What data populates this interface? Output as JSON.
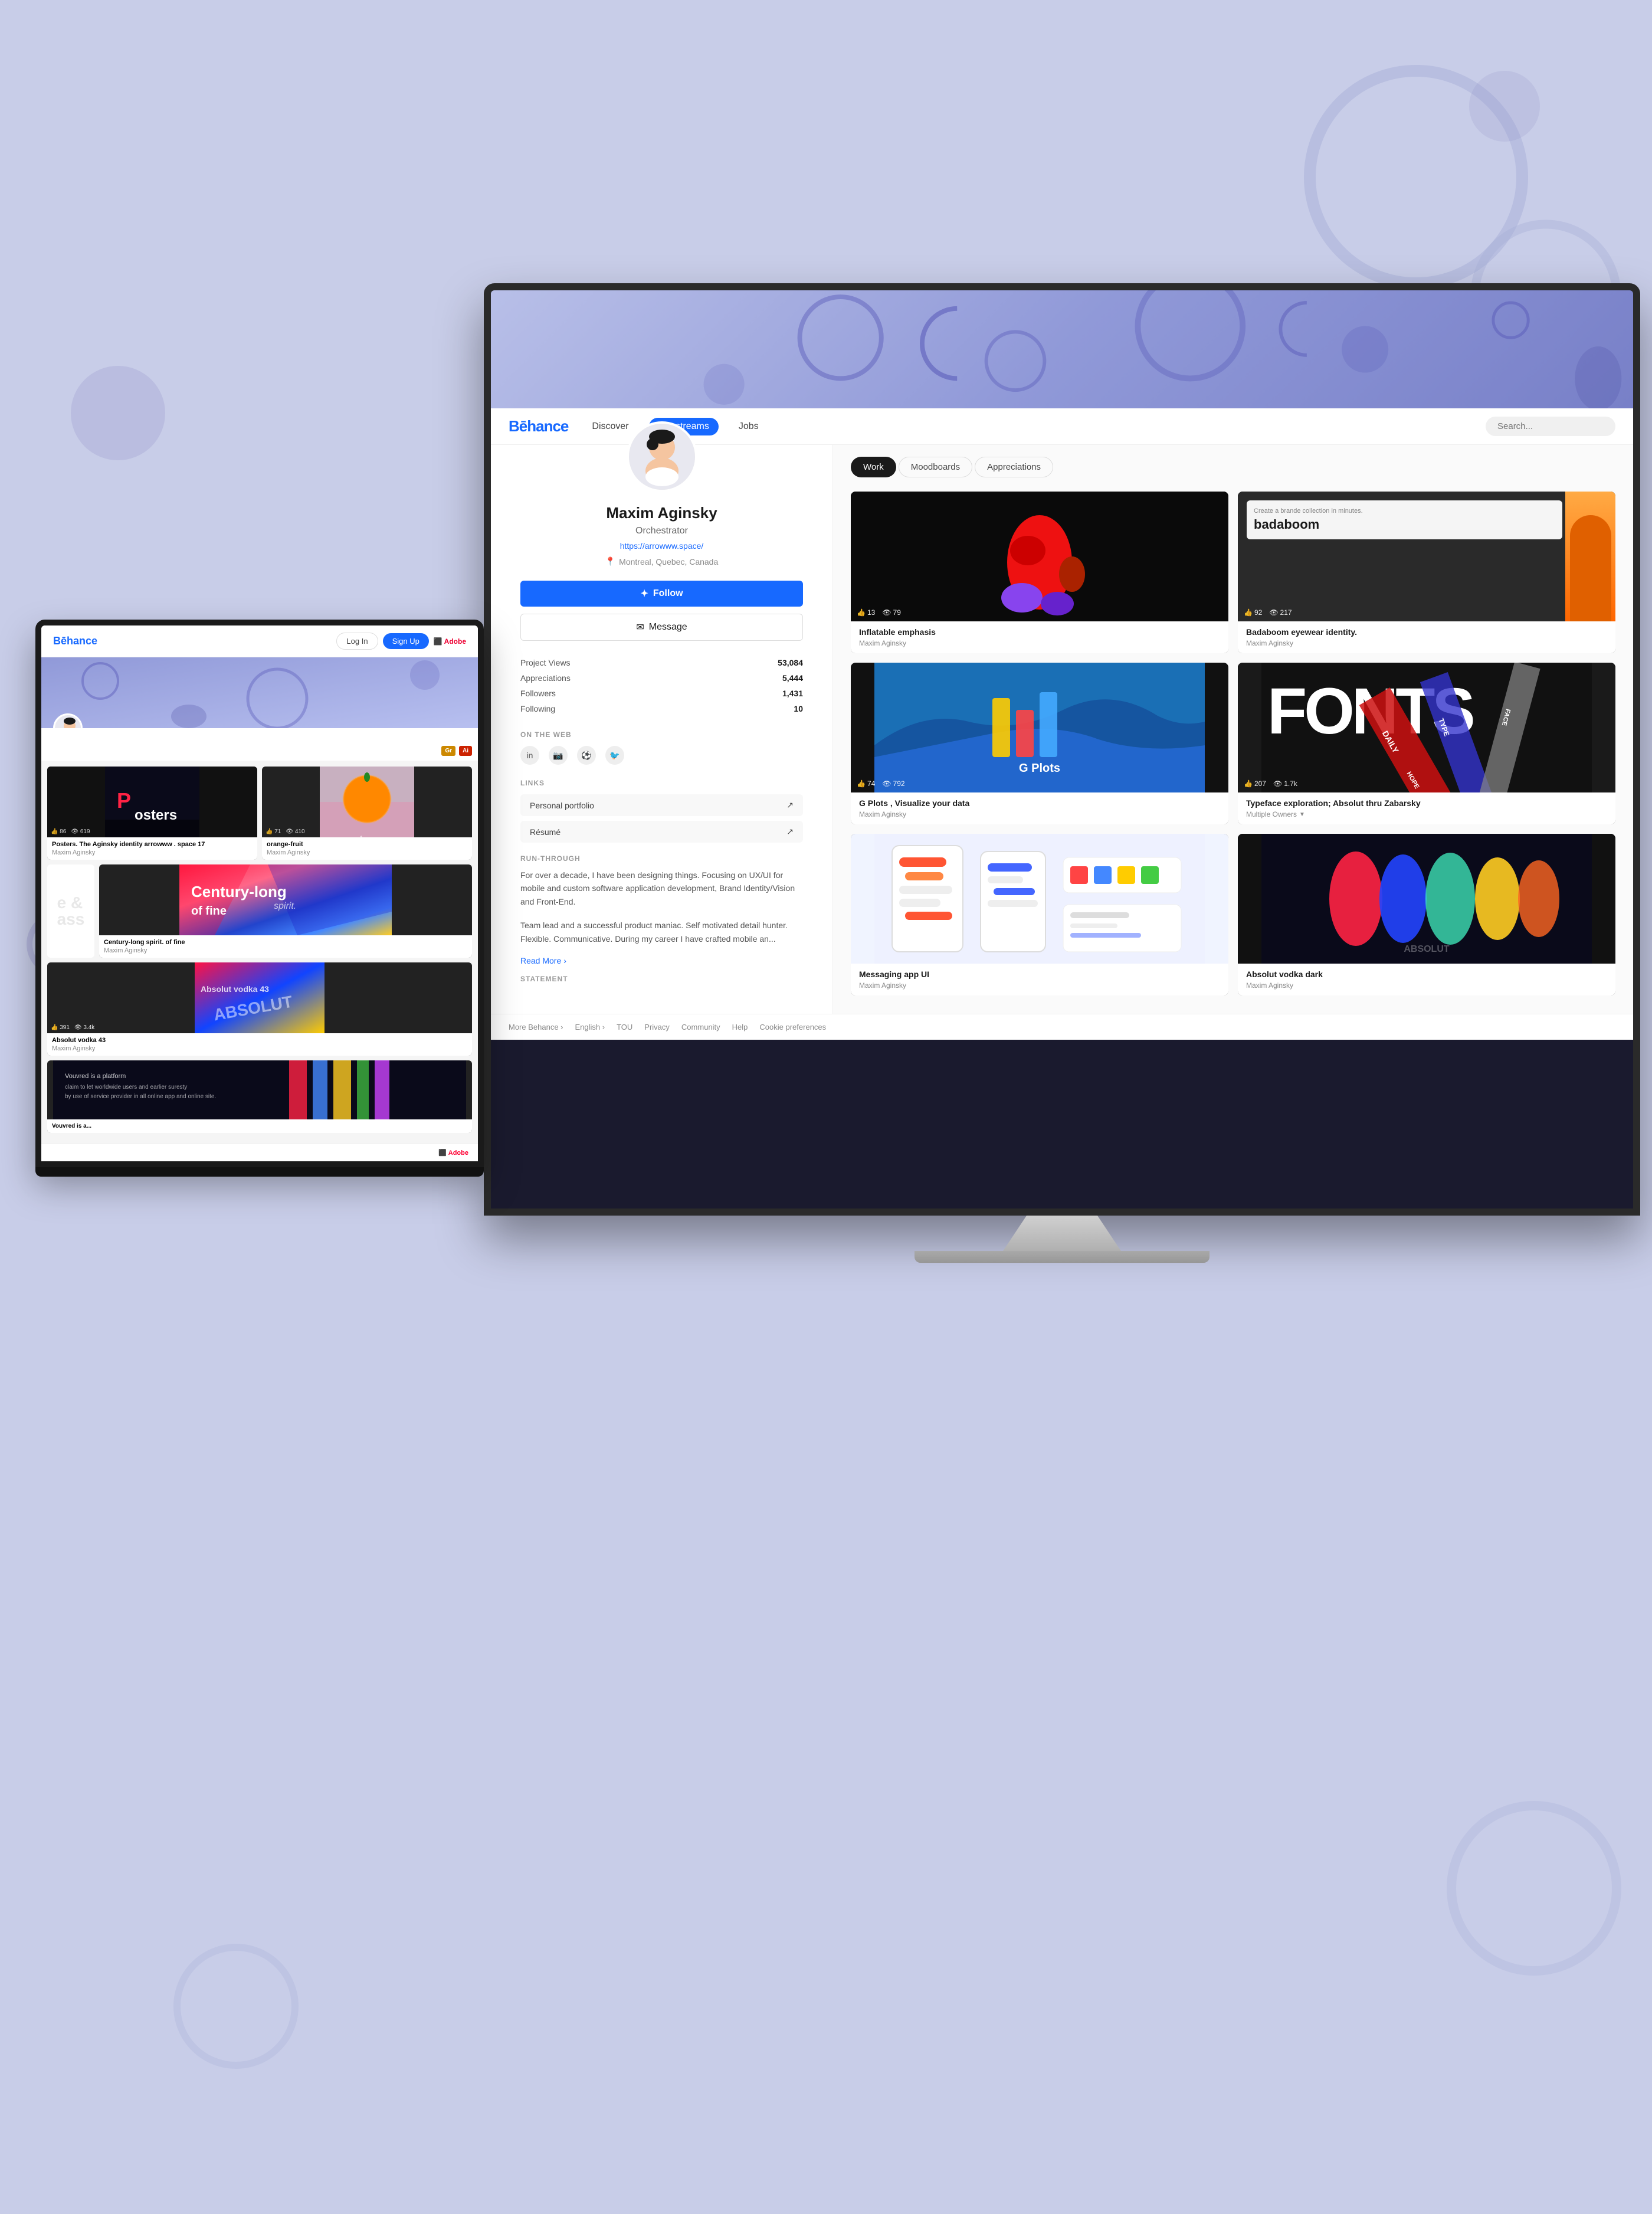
{
  "page": {
    "bg_color": "#c8cde8"
  },
  "behance": {
    "nav": {
      "logo": "Bēhance",
      "links": [
        "Discover",
        "Livestreams",
        "Jobs"
      ],
      "active_link": "Livestreams",
      "search_placeholder": "Search..."
    },
    "profile": {
      "name": "Maxim Aginsky",
      "title": "Orchestrator",
      "website": "https://arrowww.space/",
      "location": "Montreal, Quebec, Canada",
      "follow_btn": "Follow",
      "message_btn": "Message",
      "stats": {
        "project_views_label": "Project Views",
        "project_views_value": "53,084",
        "appreciations_label": "Appreciations",
        "appreciations_value": "5,444",
        "followers_label": "Followers",
        "followers_value": "1,431",
        "following_label": "Following",
        "following_value": "10"
      },
      "on_the_web_label": "ON THE WEB",
      "links_label": "LINKS",
      "links": [
        "Personal portfolio",
        "Résumé"
      ],
      "run_through_label": "RUN-THROUGH",
      "bio_text": "For over a decade, I have been designing things. Focusing on UX/UI for mobile and custom software application development, Brand Identity/Vision and Front-End.",
      "bio_text2": "Team lead and a successful product maniac. Self motivated detail hunter. Flexible. Communicative. During my career I have crafted mobile an...",
      "read_more": "Read More",
      "statement_label": "STATEMENT"
    },
    "tabs": {
      "work": "Work",
      "moodboards": "Moodboards",
      "appreciations": "Appreciations",
      "active": "Work"
    },
    "projects": [
      {
        "title": "Inflatable emphasis",
        "author": "Maxim Aginsky",
        "likes": "13",
        "views": "79",
        "style": "inflatable"
      },
      {
        "title": "Badaboom eyewear identity.",
        "author": "Maxim Aginsky",
        "likes": "92",
        "views": "217",
        "style": "badaboom"
      },
      {
        "title": "G Plots , Visualize your data",
        "author": "Maxim Aginsky",
        "likes": "74",
        "views": "792",
        "style": "gplots"
      },
      {
        "title": "Typeface exploration; Absolut thru Zabarsky",
        "author": "Multiple Owners",
        "likes": "207",
        "views": "1.7k",
        "style": "fonts",
        "has_arrow": true
      },
      {
        "title": "Messaging app UI",
        "author": "Maxim Aginsky",
        "style": "chat"
      },
      {
        "title": "Absolut vodka dark",
        "author": "Maxim Aginsky",
        "style": "absolut"
      }
    ],
    "footer": {
      "links": [
        "More Behance ›",
        "English ›",
        "TOU",
        "Privacy",
        "Community",
        "Help",
        "Cookie preferences"
      ]
    }
  },
  "tablet": {
    "nav": {
      "login": "Log In",
      "signup": "Sign Up",
      "adobe": "⬛ Adobe"
    },
    "projects": [
      {
        "title": "Posters. The Aginsky identity arrowww . space 17",
        "author": "Maxim Aginsky",
        "likes": "86",
        "views": "619",
        "style": "poster"
      },
      {
        "title": "orange-fruit",
        "author": "Maxim Aginsky",
        "likes": "71",
        "views": "410",
        "style": "orange"
      },
      {
        "title": "Century-long spirit. of fine",
        "author": "Maxim Aginsky",
        "style": "century"
      },
      {
        "title": "Absolut vodka 43",
        "author": "Maxim Aginsky",
        "likes": "391",
        "views": "3.4k",
        "style": "absolut_colorful"
      },
      {
        "title": "Vouvred is a...",
        "style": "dark_text"
      }
    ],
    "footer_logo": "⬛ Adobe"
  }
}
